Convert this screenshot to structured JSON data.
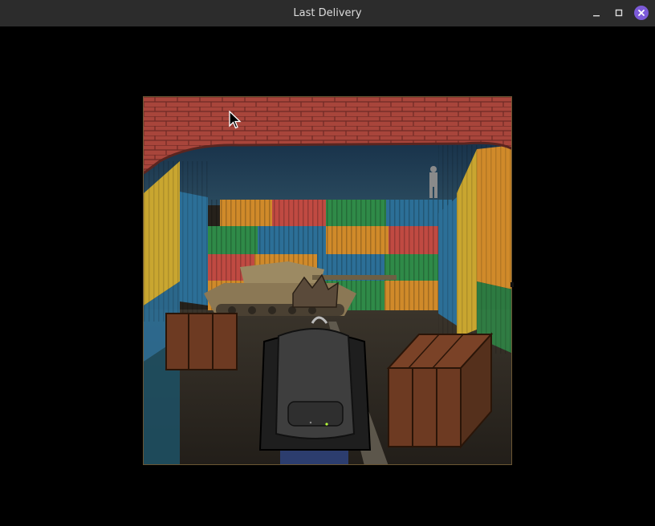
{
  "window": {
    "title": "Last Delivery",
    "buttons": [
      {
        "name": "minimize-button",
        "icon": "minimize-icon"
      },
      {
        "name": "maximize-button",
        "icon": "maximize-icon"
      },
      {
        "name": "close-button",
        "icon": "close-icon"
      }
    ],
    "close_color": "#7c5ad8"
  },
  "game": {
    "scene": "container-yard-corridor",
    "colors": {
      "brick": "#a8453b",
      "sky": "#1f3a52",
      "orange_container": "#d08a2a",
      "red_container": "#c04a42",
      "green_container": "#2f8a48",
      "blue_container": "#2c6f97",
      "yellow_container": "#c9a630",
      "crate": "#6d3a22",
      "floor": "#2e2922"
    }
  }
}
